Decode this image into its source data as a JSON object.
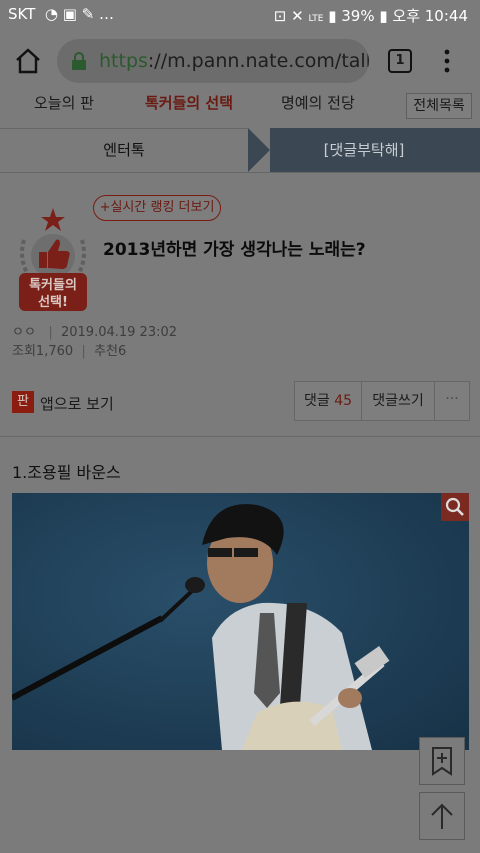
{
  "status_bar": {
    "carrier": "SKT",
    "battery": "39%",
    "time": "오후 10:44",
    "network": "LTE"
  },
  "browser": {
    "url_protocol": "https",
    "url_rest": "://m.pann.nate.com/talk/",
    "tab_count": "1"
  },
  "top_nav": {
    "items": [
      "오늘의 판",
      "톡커들의 선택",
      "명예의 전당"
    ],
    "active_index": 1,
    "all_button": "전체목록"
  },
  "sub_nav": {
    "left_tab": "엔터톡",
    "right_tab": "[댓글부탁해]"
  },
  "post": {
    "badge_text_line1": "톡커들의",
    "badge_text_line2": "선택!",
    "ranking_button": "+실시간 랭킹 더보기",
    "title": "2013년하면 가장 생각나는 노래는?",
    "author": "ㅇㅇ",
    "date": "2019.04.19 23:02",
    "views_label": "조회",
    "views": "1,760",
    "recommend_label": "추천",
    "recommend": "6"
  },
  "actions": {
    "app_icon_text": "판",
    "app_view_label": "앱으로 보기",
    "comment_label": "댓글",
    "comment_count": "45",
    "write_comment_label": "댓글쓰기",
    "more_label": "···"
  },
  "body": {
    "first_item": "1.조용필 바운스"
  },
  "colors": {
    "accent_red": "#c0392b",
    "dark_tab": "#3b4752",
    "overlay_gray": "#7b7b7b"
  },
  "icons": [
    "home-icon",
    "lock-icon",
    "tabs-icon",
    "menu-icon",
    "star-icon",
    "thumbs-up-icon",
    "zoom-icon",
    "bookmark-icon",
    "scroll-top-icon"
  ]
}
